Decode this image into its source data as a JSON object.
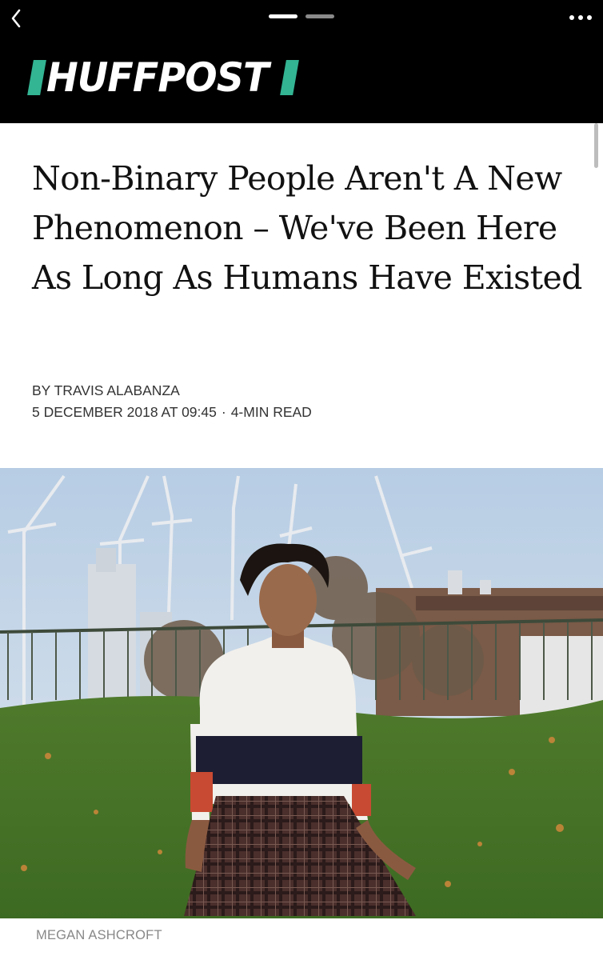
{
  "nav": {
    "back_icon": "chevron-left-icon",
    "more_icon": "more-dots-icon",
    "pager": {
      "total": 2,
      "active": 1
    }
  },
  "brand": {
    "name": "HUFFPOST",
    "accent_color": "#33b493"
  },
  "article": {
    "headline": "Non-Binary People Aren't A New Phenomenon – We've Been Here As Long As Humans Have Existed",
    "byline": "BY TRAVIS ALABANZA",
    "date": "5 DECEMBER 2018 AT 09:45",
    "separator": "·",
    "read_time": "4-MIN READ"
  },
  "photo": {
    "credit": "MEGAN ASHCROFT"
  }
}
